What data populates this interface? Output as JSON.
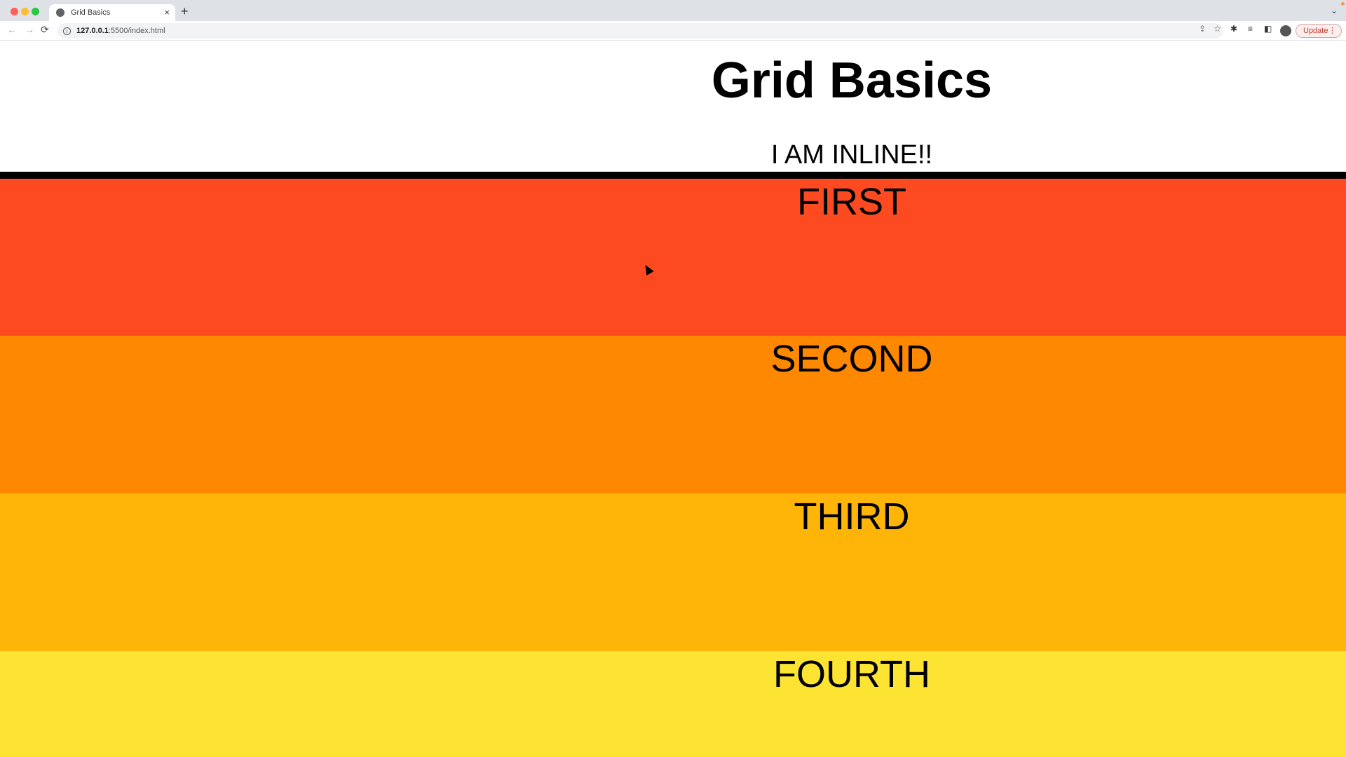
{
  "browser": {
    "tab_title": "Grid Basics",
    "new_tab_label": "+",
    "close_tab_label": "×",
    "url_host": "127.0.0.1",
    "url_path": ":5500/index.html",
    "update_label": "Update",
    "icons": {
      "back": "←",
      "forward": "→",
      "reload": "⟳",
      "info": "i",
      "share": "⇪",
      "star": "☆",
      "puzzle": "✱",
      "media": "≡",
      "sidepanel": "◧",
      "menu": "⋮",
      "chevron": "⌄"
    }
  },
  "page": {
    "heading": "Grid Basics",
    "inline_text": "I AM INLINE!!",
    "bands": [
      {
        "label": "FIRST",
        "color": "#fe4a20"
      },
      {
        "label": "SECOND",
        "color": "#ff8801"
      },
      {
        "label": "THIRD",
        "color": "#feb507"
      },
      {
        "label": "FOURTH",
        "color": "#fde432"
      }
    ],
    "divider_color": "#000000"
  }
}
